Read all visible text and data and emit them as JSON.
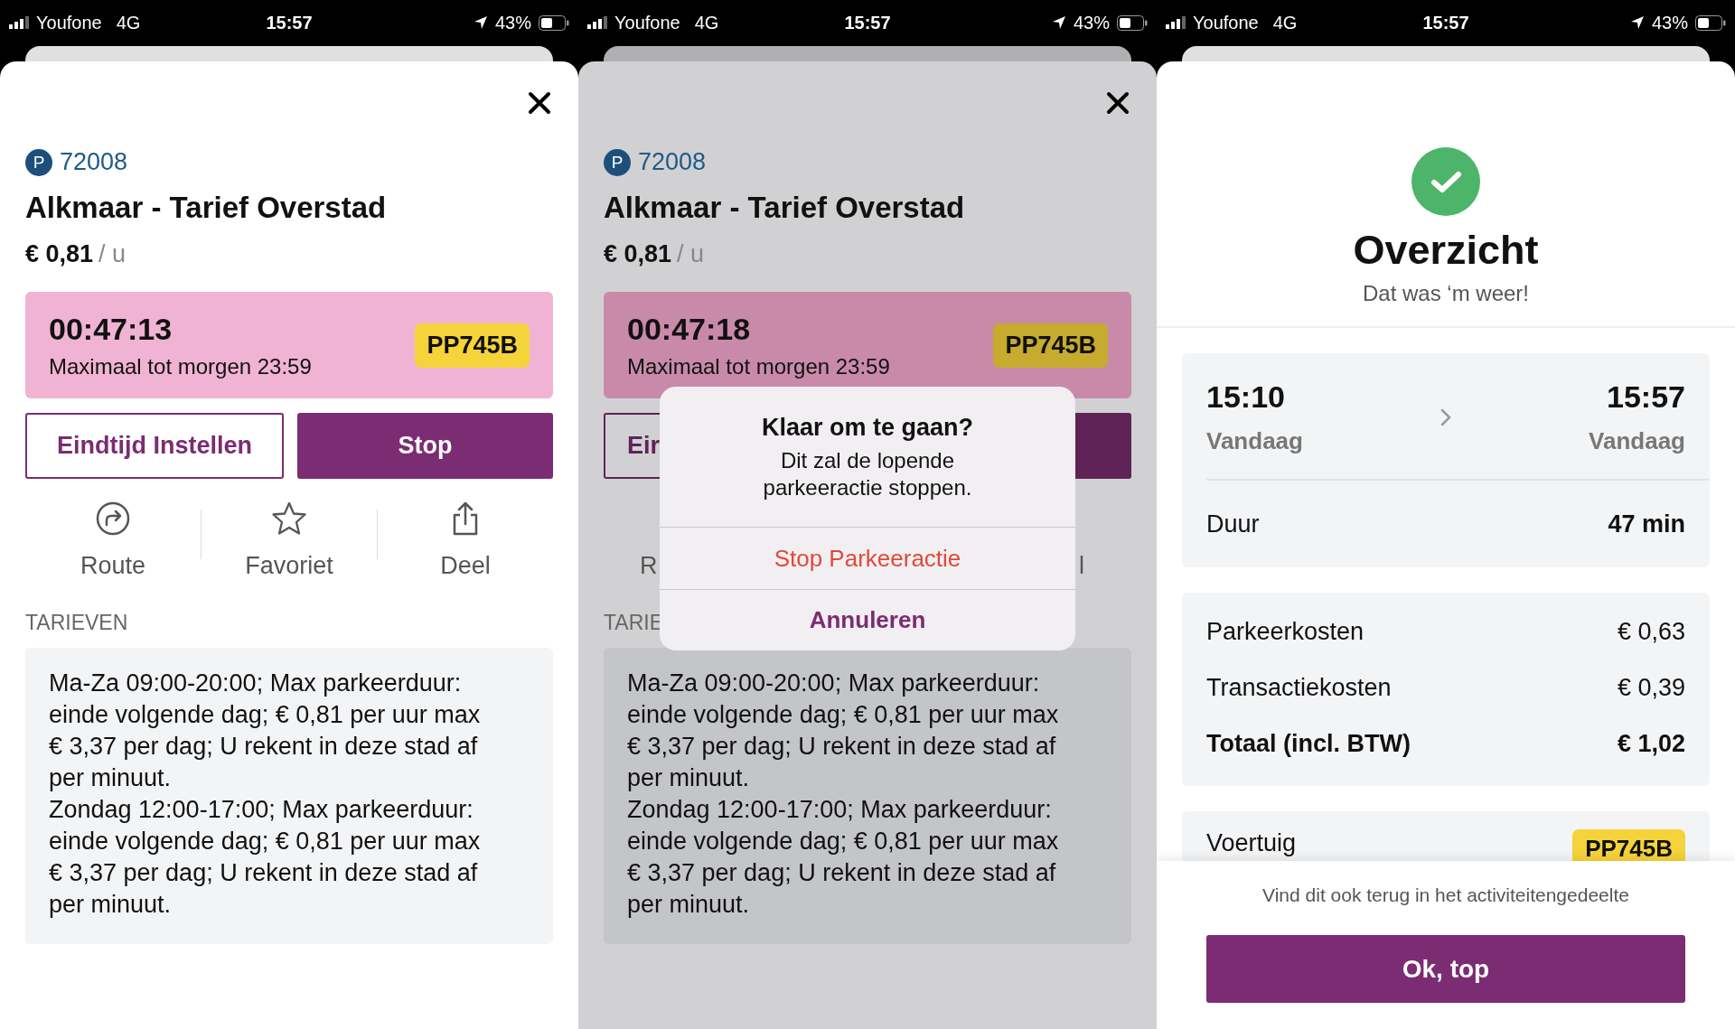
{
  "panels": [
    {
      "kind": "parking",
      "dimmed": false,
      "status_bar": {
        "carrier": "Youfone",
        "network": "4G",
        "time": "15:57",
        "battery": "43%"
      },
      "zone_badge": "P",
      "zone_code": "72008",
      "title": "Alkmaar - Tarief Overstad",
      "price": "€ 0,81",
      "price_unit": "/ u",
      "timer": "00:47:13",
      "max_note": "Maximaal tot morgen 23:59",
      "plate": "PP745B",
      "end_button": {
        "label": "Eindtijd Instellen"
      },
      "stop_button": {
        "label": "Stop"
      },
      "actions": [
        {
          "kind": "route",
          "label": "Route"
        },
        {
          "kind": "favorite",
          "label": "Favoriet"
        },
        {
          "kind": "share",
          "label": "Deel"
        }
      ],
      "section_label": "TARIEVEN",
      "rates": [
        "Ma-Za 09:00-20:00; Max parkeerduur: einde volgende dag; € 0,81 per uur max € 3,37 per dag; U rekent in deze stad af per minuut.",
        "Zondag 12:00-17:00; Max parkeerduur: einde volgende dag; € 0,81 per uur max € 3,37 per dag; U rekent in deze stad af per minuut."
      ]
    },
    {
      "kind": "parking",
      "dimmed": true,
      "status_bar": {
        "carrier": "Youfone",
        "network": "4G",
        "time": "15:57",
        "battery": "43%"
      },
      "zone_badge": "P",
      "zone_code": "72008",
      "title": "Alkmaar - Tarief Overstad",
      "price": "€ 0,81",
      "price_unit": "/ u",
      "timer": "00:47:18",
      "max_note": "Maximaal tot morgen 23:59",
      "plate": "PP745B",
      "end_button": {
        "label": "Eir"
      },
      "actions": [
        {
          "label": "R"
        },
        {
          "label": "l"
        }
      ],
      "section_label": "TARIE",
      "rates": [
        "Ma-Za 09:00-20:00; Max parkeerduur: einde volgende dag; € 0,81 per uur max € 3,37 per dag; U rekent in deze stad af per minuut.",
        "Zondag 12:00-17:00; Max parkeerduur: einde volgende dag; € 0,81 per uur max € 3,37 per dag; U rekent in deze stad af per minuut."
      ],
      "alert": {
        "title": "Klaar om te gaan?",
        "message": "Dit zal de lopende parkeeractie stoppen.",
        "actions": [
          {
            "label": "Stop Parkeeractie",
            "kind": "destructive"
          },
          {
            "label": "Annuleren",
            "kind": "cancel"
          }
        ]
      }
    },
    {
      "kind": "summary",
      "status_bar": {
        "carrier": "Youfone",
        "network": "4G",
        "time": "15:57",
        "battery": "43%"
      },
      "title": "Overzicht",
      "subtitle": "Dat was ‘m weer!",
      "period": {
        "start_time": "15:10",
        "start_day": "Vandaag",
        "end_time": "15:57",
        "end_day": "Vandaag"
      },
      "duration": {
        "label": "Duur",
        "value": "47 min"
      },
      "costs": [
        {
          "label": "Parkeerkosten",
          "value": "€ 0,63",
          "kind": "line"
        },
        {
          "label": "Transactiekosten",
          "value": "€ 0,39",
          "kind": "line"
        },
        {
          "label": "Totaal (incl. BTW)",
          "value": "€ 1,02",
          "kind": "total"
        }
      ],
      "vehicle": {
        "label": "Voertuig",
        "plate": "PP745B"
      },
      "footer_note": "Vind dit ook terug in het activiteitengedeelte",
      "ok_button": "Ok, top"
    }
  ]
}
